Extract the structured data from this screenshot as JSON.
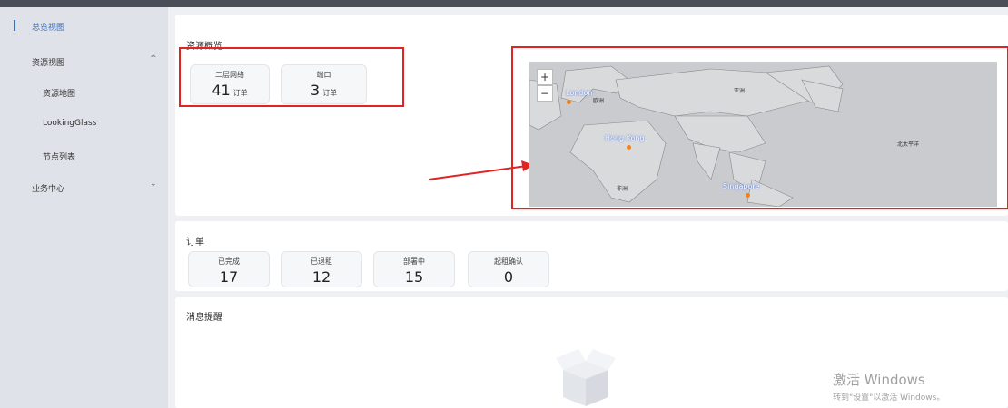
{
  "sidebar": {
    "items": [
      {
        "label": "总览视图"
      },
      {
        "label": "资源视图"
      },
      {
        "label": "资源地图"
      },
      {
        "label": "LookingGlass"
      },
      {
        "label": "节点列表"
      },
      {
        "label": "业务中心"
      }
    ]
  },
  "resource_overview": {
    "title": "资源概览",
    "cards": [
      {
        "label": "二层网络",
        "value": "41",
        "unit": "订单"
      },
      {
        "label": "端口",
        "value": "3",
        "unit": "订单"
      }
    ]
  },
  "map": {
    "zoom_in": "+",
    "zoom_out": "−",
    "cities": [
      {
        "name": "London"
      },
      {
        "name": "Hong Kong"
      },
      {
        "name": "Singapore"
      }
    ],
    "regions": [
      {
        "name": "欧洲"
      },
      {
        "name": "亚洲"
      },
      {
        "name": "北太平洋"
      },
      {
        "name": "非洲"
      }
    ]
  },
  "orders": {
    "title": "订单",
    "cards": [
      {
        "label": "已完成",
        "value": "17"
      },
      {
        "label": "已退租",
        "value": "12"
      },
      {
        "label": "部署中",
        "value": "15"
      },
      {
        "label": "起租确认",
        "value": "0"
      }
    ]
  },
  "messages": {
    "title": "消息提醒"
  },
  "os_watermark": {
    "line1": "激活 Windows",
    "line2": "转到\"设置\"以激活 Windows。"
  },
  "colors": {
    "accent": "#2f6fe0",
    "highlight": "#e02424",
    "map_marker": "#f08020"
  }
}
